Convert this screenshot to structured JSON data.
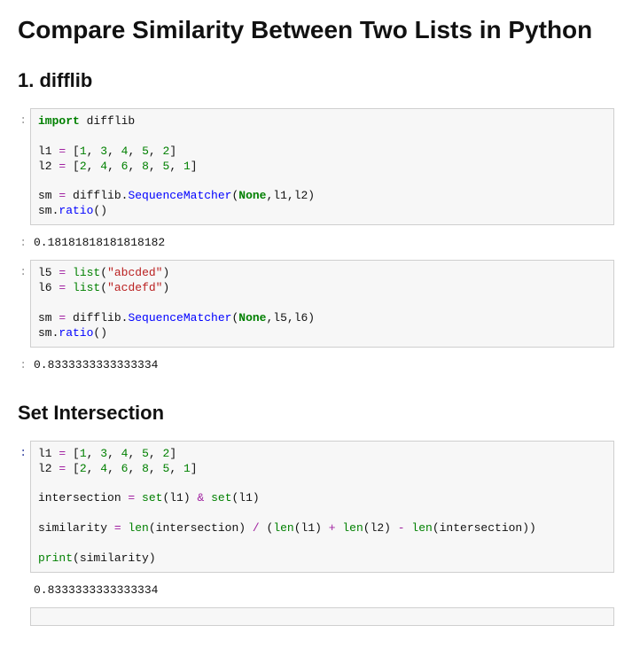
{
  "title": "Compare Similarity Between Two Lists in Python",
  "section1": "1. difflib",
  "cell1_output": "0.18181818181818182",
  "cell2_output": "0.8333333333333334",
  "section2": "Set Intersection",
  "cell3_output": "0.8333333333333334",
  "prompt_char": ":",
  "chart_data": null,
  "code": {
    "cell1": {
      "l1": [
        1,
        3,
        4,
        5,
        2
      ],
      "l2": [
        2,
        4,
        6,
        8,
        5,
        1
      ],
      "lines": [
        "import difflib",
        "",
        "l1 = [1, 3, 4, 5, 2]",
        "l2 = [2, 4, 6, 8, 5, 1]",
        "",
        "sm = difflib.SequenceMatcher(None,l1,l2)",
        "sm.ratio()"
      ]
    },
    "cell2": {
      "l5": "abcded",
      "l6": "acdefd",
      "lines": [
        "l5 = list(\"abcded\")",
        "l6 = list(\"acdefd\")",
        "",
        "sm = difflib.SequenceMatcher(None,l5,l6)",
        "sm.ratio()"
      ]
    },
    "cell3": {
      "l1": [
        1,
        3,
        4,
        5,
        2
      ],
      "l2": [
        2,
        4,
        6,
        8,
        5,
        1
      ],
      "lines": [
        "l1 = [1, 3, 4, 5, 2]",
        "l2 = [2, 4, 6, 8, 5, 1]",
        "",
        "intersection = set(l1) & set(l1)",
        "",
        "similarity = len(intersection) / (len(l1) + len(l2) - len(intersection))",
        "",
        "print(similarity)"
      ]
    }
  }
}
